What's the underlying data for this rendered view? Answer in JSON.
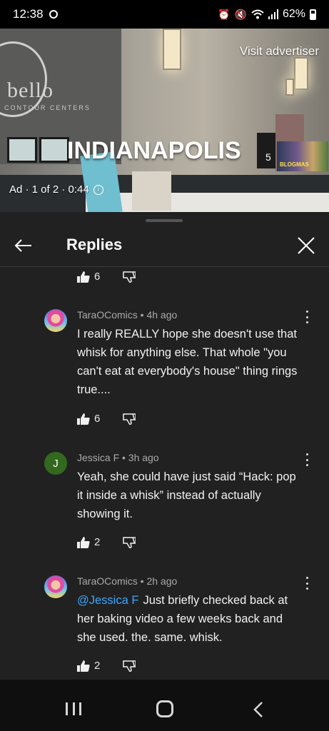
{
  "status_bar": {
    "time": "12:38",
    "battery": "62%",
    "icons": [
      "alarm-icon",
      "mute-icon",
      "wifi-icon",
      "signal-icon",
      "battery-icon"
    ]
  },
  "ad": {
    "headline": "INDIANAPOLIS",
    "number": "5",
    "thumb_tag": "BLOGMAS",
    "visit": "Visit advertiser",
    "info": "Ad · 1 of 2 · 0:44",
    "logo_brand": "bello",
    "logo_sub": "CONTOUR CENTERS"
  },
  "header": {
    "title": "Replies"
  },
  "top_item": {
    "likes": "6"
  },
  "comments": [
    {
      "author": "TaraOComics",
      "time": "4h ago",
      "meta": "TaraOComics • 4h ago",
      "text": "I really REALLY hope she doesn't use that whisk for anything else. That whole \"you can't eat at everybody's house\" thing rings true....",
      "likes": "6"
    },
    {
      "author": "Jessica F",
      "time": "3h ago",
      "meta": "Jessica F • 3h ago",
      "avatar_initial": "J",
      "text": "Yeah, she could have just said “Hack: pop it inside a whisk” instead of actually showing it.",
      "likes": "2"
    },
    {
      "author": "TaraOComics",
      "time": "2h ago",
      "meta": "TaraOComics • 2h ago",
      "mention": "@Jessica F",
      "text": "Just briefly checked back at her baking video a few weeks back and she used. the. same. whisk.",
      "likes": "2"
    }
  ],
  "colors": {
    "sheet_bg": "#212121",
    "mention": "#3ea6ff",
    "meta": "#aaaaaa",
    "avatar_j": "#33691e"
  }
}
